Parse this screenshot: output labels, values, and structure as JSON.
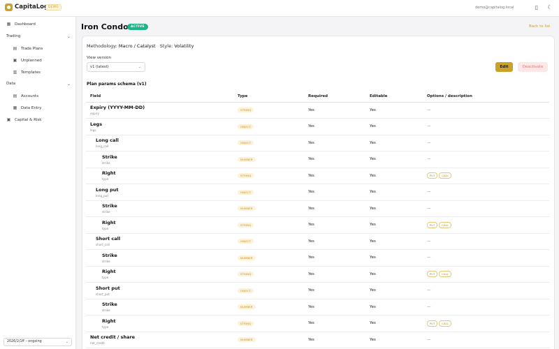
{
  "header": {
    "brand": "CapitaLog",
    "env_badge": "DEMO",
    "user_email": "demo@capitalog.local",
    "icons": [
      "layout-icon",
      "moon-icon"
    ]
  },
  "sidebar": {
    "dashboard": "Dashboard",
    "group_trading": "Trading",
    "trade_plans": "Trade Plans",
    "unplanned": "Unplanned",
    "templates": "Templates",
    "group_data": "Data",
    "accounts": "Accounts",
    "data_entry": "Data Entry",
    "capital_risk": "Capital & Risk",
    "period_select": "2026/2/1ff – ongoing"
  },
  "page": {
    "title": "Iron Condor",
    "status": "ACTIVE",
    "back": "Back to list",
    "methodology_label": "Methodology:",
    "methodology_value": "Macro / Catalyst",
    "style_label": "Style:",
    "style_value": "Volatility",
    "view_version_label": "View version",
    "view_version_value": "v1 (latest)",
    "edit": "Edit",
    "deactivate": "Deactivate",
    "schema_title": "Plan params schema (v1)"
  },
  "table": {
    "headers": {
      "field": "Field",
      "type": "Type",
      "required": "Required",
      "editable": "Editable",
      "options": "Options / description"
    },
    "rows": [
      {
        "level": 0,
        "name": "Expiry (YYYY-MM-DD)",
        "key": "expiry",
        "type": "STRING",
        "required": "Yes",
        "editable": "Yes",
        "options": "—"
      },
      {
        "level": 0,
        "name": "Legs",
        "key": "legs",
        "type": "OBJECT",
        "required": "Yes",
        "editable": "Yes",
        "options": "—"
      },
      {
        "level": 1,
        "name": "Long call",
        "key": "long_call",
        "type": "OBJECT",
        "required": "Yes",
        "editable": "Yes",
        "options": "—"
      },
      {
        "level": 2,
        "name": "Strike",
        "key": "strike",
        "type": "NUMBER",
        "required": "Yes",
        "editable": "Yes",
        "options": "—"
      },
      {
        "level": 2,
        "name": "Right",
        "key": "type",
        "type": "STRING",
        "required": "Yes",
        "editable": "Yes",
        "options": [
          "PUT",
          "CALL"
        ]
      },
      {
        "level": 1,
        "name": "Long put",
        "key": "long_put",
        "type": "OBJECT",
        "required": "Yes",
        "editable": "Yes",
        "options": "—"
      },
      {
        "level": 2,
        "name": "Strike",
        "key": "strike",
        "type": "NUMBER",
        "required": "Yes",
        "editable": "Yes",
        "options": "—"
      },
      {
        "level": 2,
        "name": "Right",
        "key": "type",
        "type": "STRING",
        "required": "Yes",
        "editable": "Yes",
        "options": [
          "PUT",
          "CALL"
        ]
      },
      {
        "level": 1,
        "name": "Short call",
        "key": "short_call",
        "type": "OBJECT",
        "required": "Yes",
        "editable": "Yes",
        "options": "—"
      },
      {
        "level": 2,
        "name": "Strike",
        "key": "strike",
        "type": "NUMBER",
        "required": "Yes",
        "editable": "Yes",
        "options": "—"
      },
      {
        "level": 2,
        "name": "Right",
        "key": "type",
        "type": "STRING",
        "required": "Yes",
        "editable": "Yes",
        "options": [
          "PUT",
          "CALL"
        ]
      },
      {
        "level": 1,
        "name": "Short put",
        "key": "short_put",
        "type": "OBJECT",
        "required": "Yes",
        "editable": "Yes",
        "options": "—"
      },
      {
        "level": 2,
        "name": "Strike",
        "key": "strike",
        "type": "NUMBER",
        "required": "Yes",
        "editable": "Yes",
        "options": "—"
      },
      {
        "level": 2,
        "name": "Right",
        "key": "type",
        "type": "STRING",
        "required": "Yes",
        "editable": "Yes",
        "options": [
          "PUT",
          "CALL"
        ]
      },
      {
        "level": 0,
        "name": "Net credit / share",
        "key": "net_credit",
        "type": "NUMBER",
        "required": "Yes",
        "editable": "Yes",
        "options": "—"
      }
    ]
  },
  "colors": {
    "accent": "#c9a227",
    "active": "#1fb38a",
    "danger_bg": "#fde8e8",
    "danger_text": "#e07777"
  }
}
